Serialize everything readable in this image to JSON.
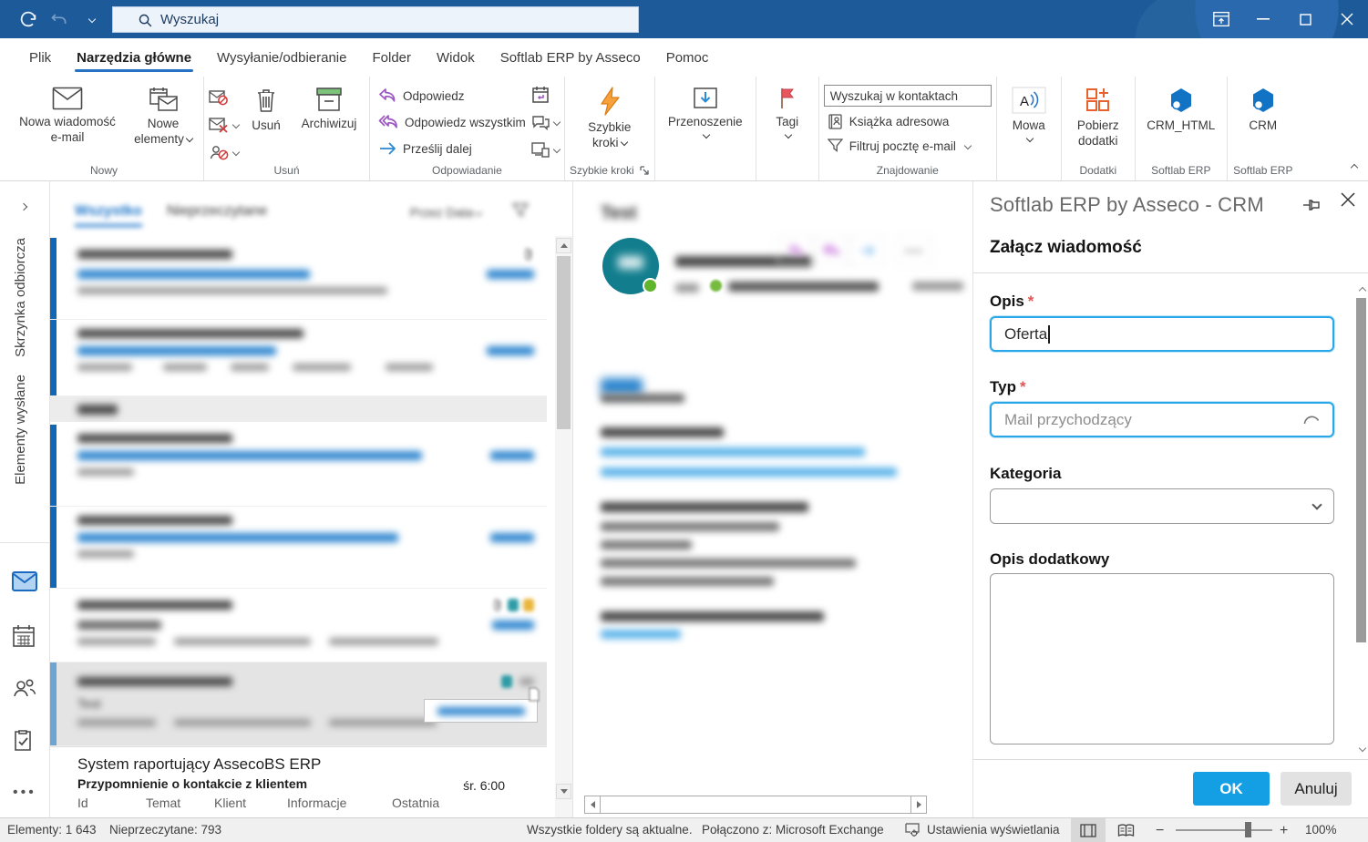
{
  "titlebar": {
    "search_value": "Wyszukaj"
  },
  "menu": {
    "tabs": [
      {
        "label": "Plik"
      },
      {
        "label": "Narzędzia główne",
        "active": true
      },
      {
        "label": "Wysyłanie/odbieranie"
      },
      {
        "label": "Folder"
      },
      {
        "label": "Widok"
      },
      {
        "label": "Softlab ERP by Asseco"
      },
      {
        "label": "Pomoc"
      }
    ]
  },
  "ribbon": {
    "new_mail": "Nowa wiadomość\ne-mail",
    "new_items": "Nowe\nelementy",
    "delete": "Usuń",
    "archive": "Archiwizuj",
    "reply": "Odpowiedz",
    "reply_all": "Odpowiedz wszystkim",
    "forward": "Prześlij dalej",
    "quick_steps": "Szybkie\nkroki",
    "move": "Przenoszenie",
    "tags": "Tagi",
    "search_contacts": "Wyszukaj w kontaktach",
    "address_book": "Książka adresowa",
    "filter_email": "Filtruj pocztę e-mail",
    "speech": "Mowa",
    "get_addins": "Pobierz\ndodatki",
    "crm_html": "CRM_HTML",
    "crm": "CRM",
    "group_labels": {
      "new": "Nowy",
      "delete": "Usuń",
      "respond": "Odpowiadanie",
      "quick_steps": "Szybkie kroki",
      "find": "Znajdowanie",
      "addins": "Dodatki",
      "softlab1": "Softlab ERP",
      "softlab2": "Softlab ERP"
    }
  },
  "rail": {
    "inbox": "Skrzynka odbiorcza",
    "sent": "Elementy wysłane"
  },
  "list": {
    "tab_all": "Wszystko",
    "tab_unread": "Nieprzeczytane",
    "sort_by": "Przez Data",
    "bottom_item": {
      "sender": "System raportujący AssecoBS ERP",
      "subject": "Przypomnienie o kontakcie z klientem",
      "date": "śr. 6:00",
      "preview_columns": [
        "Id",
        "Temat",
        "Klient",
        "Informacje",
        "Ostatnia"
      ]
    }
  },
  "reading": {
    "subject": "Test"
  },
  "crm_panel": {
    "title": "Softlab ERP by Asseco - CRM",
    "heading": "Załącz wiadomość",
    "required_marker": "*",
    "opis_label": "Opis",
    "opis_value": "Oferta",
    "typ_label": "Typ",
    "typ_value": "Mail przychodzący",
    "kategoria_label": "Kategoria",
    "kategoria_value": "",
    "opis_dodatkowy_label": "Opis dodatkowy",
    "opis_dodatkowy_value": "",
    "ok": "OK",
    "cancel": "Anuluj"
  },
  "status": {
    "items": "Elementy: 1 643",
    "unread": "Nieprzeczytane: 793",
    "folders": "Wszystkie foldery są aktualne.",
    "connection": "Połączono z: Microsoft Exchange",
    "display_settings": "Ustawienia wyświetlania",
    "zoom": "100%"
  },
  "colors": {
    "titlebar": "#1d5a9a",
    "accent_blue": "#2672c4",
    "unread_bar": "#1267b4",
    "subject_blue": "#2e86cf",
    "ok_button": "#149fe4",
    "lightning_orange": "#f6a13b",
    "flag_red": "#e8565e",
    "crm_cube_blue": "#1273c4",
    "avatar_teal": "#117d8d",
    "presence_green": "#61b52d"
  }
}
